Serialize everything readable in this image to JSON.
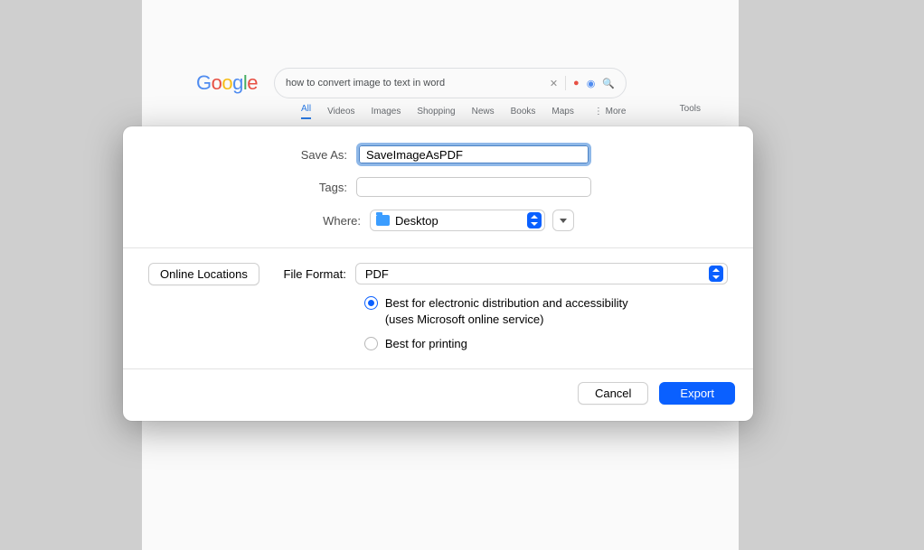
{
  "background": {
    "logo_letters": [
      "G",
      "o",
      "o",
      "g",
      "l",
      "e"
    ],
    "search_query": "how to convert image to text in word",
    "nav": {
      "all": "All",
      "videos": "Videos",
      "images": "Images",
      "shopping": "Shopping",
      "news": "News",
      "books": "Books",
      "maps": "Maps",
      "more": "More",
      "tools": "Tools"
    }
  },
  "dialog": {
    "save_as_label": "Save As:",
    "save_as_value": "SaveImageAsPDF",
    "tags_label": "Tags:",
    "tags_value": "",
    "where_label": "Where:",
    "where_value": "Desktop",
    "online_locations": "Online Locations",
    "file_format_label": "File Format:",
    "file_format_value": "PDF",
    "radio1_line1": "Best for electronic distribution and accessibility",
    "radio1_line2": "(uses Microsoft online service)",
    "radio2": "Best for printing",
    "cancel": "Cancel",
    "export": "Export"
  }
}
